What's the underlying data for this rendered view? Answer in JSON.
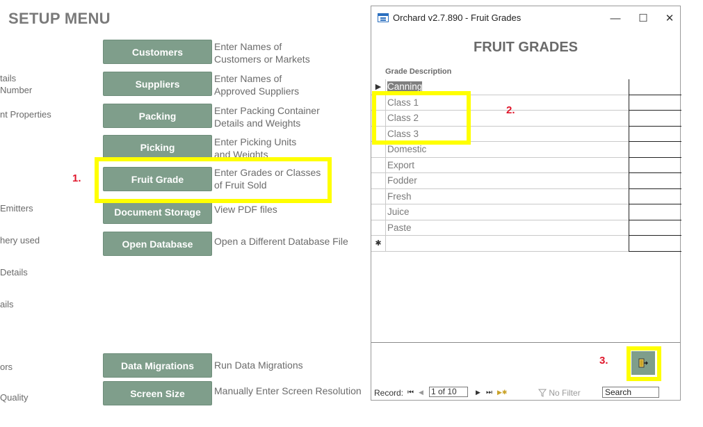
{
  "setup": {
    "title": "SETUP MENU",
    "left_labels": [
      "tails",
      "Number",
      "nt Properties",
      "Emitters",
      "hery used",
      "Details",
      "ails",
      "ors",
      "Quality"
    ],
    "buttons": [
      {
        "label": "Customers",
        "desc": "Enter Names of\nCustomers or Markets"
      },
      {
        "label": "Suppliers",
        "desc": "Enter Names of\nApproved  Suppliers"
      },
      {
        "label": "Packing",
        "desc": "Enter Packing Container\nDetails and Weights"
      },
      {
        "label": "Picking",
        "desc": "Enter Picking Units\nand Weights"
      },
      {
        "label": "Fruit Grade",
        "desc": "Enter Grades or Classes\nof Fruit Sold"
      },
      {
        "label": "Document Storage",
        "desc": "View PDF files"
      },
      {
        "label": "Open Database",
        "desc": "Open a Different Database File"
      },
      {
        "label": "Data Migrations",
        "desc": "Run Data Migrations"
      },
      {
        "label": "Screen Size",
        "desc": "Manually Enter Screen Resolution"
      }
    ]
  },
  "annotations": {
    "step1": "1.",
    "step2": "2.",
    "step3": "3.",
    "highlight_color": "#ffff00",
    "step_color": "#e0162b"
  },
  "dialog": {
    "window_title": "Orchard v2.7.890 - Fruit Grades",
    "minimize_glyph": "—",
    "maximize_glyph": "☐",
    "close_glyph": "✕",
    "heading": "FRUIT GRADES",
    "column_header": "Grade Description",
    "current_marker": "▶",
    "new_record_marker": "✱",
    "grades": [
      "Canning",
      "Class 1",
      "Class 2",
      "Class 3",
      "Domestic",
      "Export",
      "Fodder",
      "Fresh",
      "Juice",
      "Paste"
    ],
    "exit_icon": "exit-door-icon",
    "navigation": {
      "record_label": "Record:",
      "first_glyph": "⏮",
      "prev_glyph": "◀",
      "position": "1 of 10",
      "next_glyph": "▶",
      "last_glyph": "⏭",
      "new_glyph": "▶✱",
      "filter_label": "No Filter",
      "search_placeholder": "Search"
    }
  }
}
